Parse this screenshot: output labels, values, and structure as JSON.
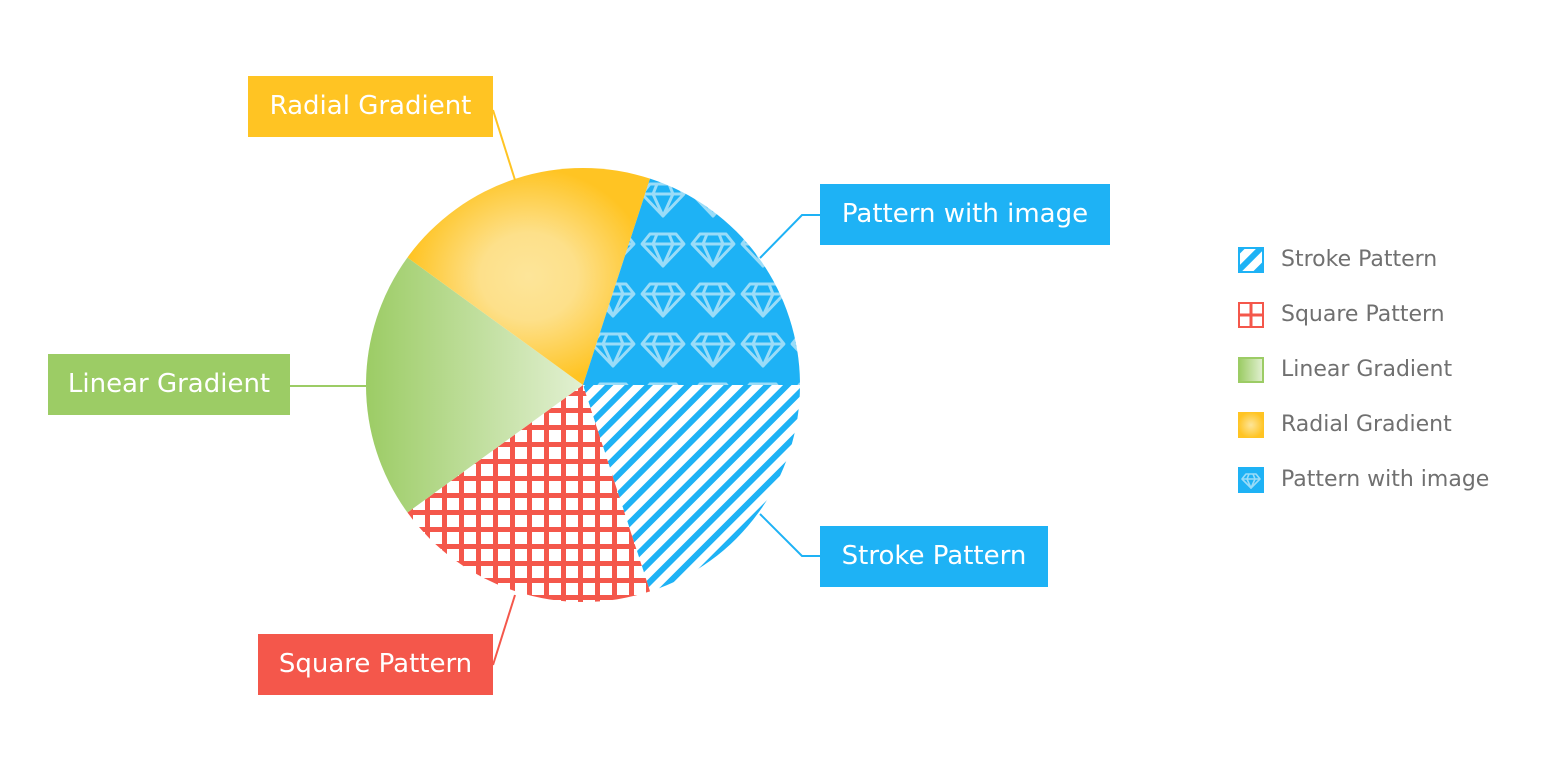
{
  "chart_data": {
    "type": "pie",
    "start_angle": "east, clockwise",
    "slices": [
      {
        "name": "Stroke Pattern",
        "value": 20,
        "color": "#1eb2f5",
        "fill": "diagonal stripes"
      },
      {
        "name": "Square Pattern",
        "value": 20,
        "color": "#f4574b",
        "fill": "grid squares"
      },
      {
        "name": "Linear Gradient",
        "value": 20,
        "color": "#9ccc65",
        "fill": "linear gradient"
      },
      {
        "name": "Radial Gradient",
        "value": 20,
        "color": "#ffc423",
        "fill": "radial gradient"
      },
      {
        "name": "Pattern with image",
        "value": 20,
        "color": "#1eb2f5",
        "fill": "diamond image pattern"
      }
    ],
    "legend_position": "right",
    "data_labels": "outside with connector lines"
  }
}
